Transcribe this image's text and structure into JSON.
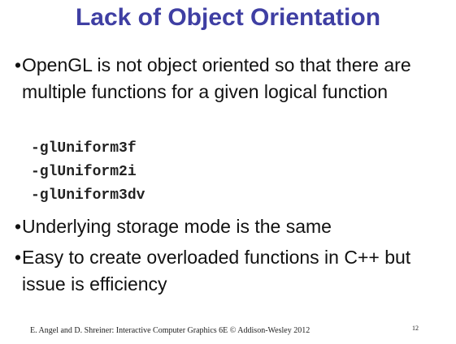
{
  "slide": {
    "title": "Lack of Object Orientation",
    "bullets": [
      {
        "marker": "•",
        "text": "OpenGL is not object oriented so that there are multiple functions for a given logical function"
      },
      {
        "marker": "•",
        "text": "Underlying storage mode is the same"
      },
      {
        "marker": "•",
        "text": "Easy to create overloaded functions in C++ but issue is efficiency"
      }
    ],
    "code_items": [
      "-glUniform3f",
      "-glUniform2i",
      "-glUniform3dv"
    ],
    "footer": "E. Angel and D. Shreiner: Interactive Computer Graphics 6E © Addison-Wesley 2012",
    "page_number": "12"
  }
}
